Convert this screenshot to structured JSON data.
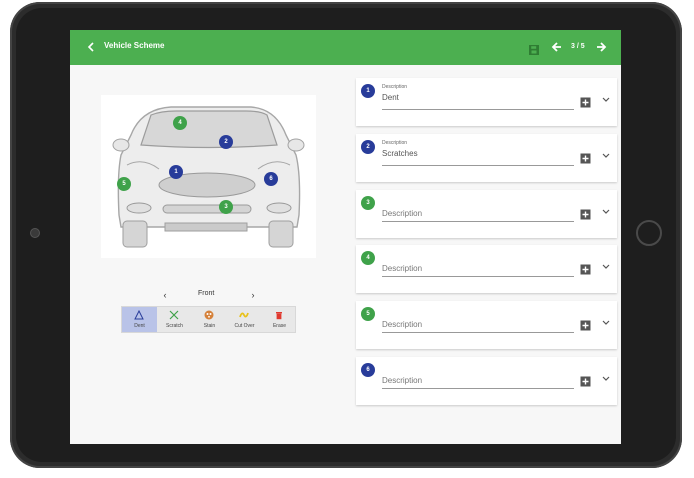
{
  "header": {
    "title": "Vehicle Scheme",
    "page_indicator": "3 / 5",
    "color": "#4caf50"
  },
  "markers": [
    {
      "id": "1",
      "color": "#283c9a"
    },
    {
      "id": "2",
      "color": "#283c9a"
    },
    {
      "id": "3",
      "color": "#3fa24a"
    },
    {
      "id": "4",
      "color": "#3fa24a"
    },
    {
      "id": "5",
      "color": "#3fa24a"
    },
    {
      "id": "6",
      "color": "#283c9a"
    }
  ],
  "view": {
    "label": "Front"
  },
  "tools": [
    {
      "label": "Dent",
      "icon": "triangle-icon",
      "active": true
    },
    {
      "label": "Scratch",
      "icon": "cross-icon"
    },
    {
      "label": "Stain",
      "icon": "stain-icon"
    },
    {
      "label": "Cut Over",
      "icon": "cut-over-icon"
    },
    {
      "label": "Erase",
      "icon": "trash-icon"
    }
  ],
  "descriptions": [
    {
      "number": "1",
      "label": "Description",
      "value": "Dent"
    },
    {
      "number": "2",
      "label": "Description",
      "value": "Scratches"
    },
    {
      "number": "3",
      "placeholder": "Description"
    },
    {
      "number": "4",
      "placeholder": "Description"
    },
    {
      "number": "5",
      "placeholder": "Description"
    },
    {
      "number": "6",
      "placeholder": "Description"
    }
  ]
}
